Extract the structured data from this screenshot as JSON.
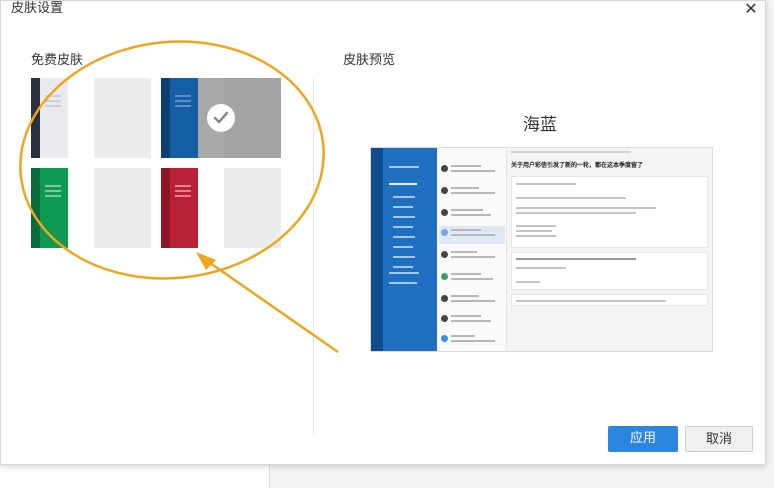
{
  "dialog": {
    "title": "皮肤设置",
    "close_icon": "close-icon"
  },
  "left_panel": {
    "heading": "免费皮肤",
    "skins": [
      {
        "id": "skin-dark-gray",
        "sidebar": "#2b3240",
        "nav": "#eceef1",
        "line": "#c9cbd0",
        "selected": false
      },
      {
        "id": "skin-sea-blue",
        "sidebar": "#0d3f72",
        "nav": "#155ea5",
        "line": "#5e8fc4",
        "selected": true
      },
      {
        "id": "skin-green",
        "sidebar": "#0a6b3a",
        "nav": "#0e9a51",
        "line": "#7cc6a0",
        "selected": false
      },
      {
        "id": "skin-red",
        "sidebar": "#8e1428",
        "nav": "#b82036",
        "line": "#e07f8d",
        "selected": false
      }
    ]
  },
  "right_panel": {
    "heading": "皮肤预览",
    "skin_name": "海蓝",
    "preview_subject": "关于用户彩信引发了新的一轮，都在这本季度留了"
  },
  "footer": {
    "apply_label": "应用",
    "cancel_label": "取消"
  },
  "colors": {
    "accent": "#2b86e0",
    "annotation": "#f0a51e"
  }
}
